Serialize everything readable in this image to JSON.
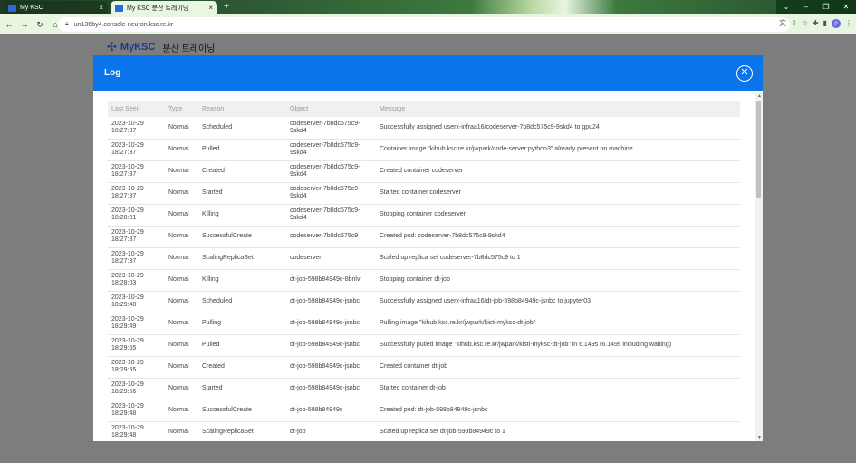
{
  "browser": {
    "tabs": [
      {
        "title": "My KSC"
      },
      {
        "title": "My KSC 분산 트레이닝"
      }
    ],
    "url": "un136by4.console-neuron.ksc.re.kr",
    "profile_initial": "p"
  },
  "page": {
    "brand": "MyKSC",
    "subtitle": "분산 트레이닝"
  },
  "modal": {
    "title": "Log",
    "columns": [
      "Last Seen",
      "Type",
      "Reason",
      "Object",
      "Message"
    ],
    "rows": [
      {
        "last_seen": "2023-10-29 18:27:37",
        "type": "Normal",
        "reason": "Scheduled",
        "object": "codeserver-7b8dc575c9-9skd4",
        "message": "Successfully assigned userx-infraa16/codeserver-7b8dc575c9-9skd4 to gpu24"
      },
      {
        "last_seen": "2023-10-29 18:27:37",
        "type": "Normal",
        "reason": "Pulled",
        "object": "codeserver-7b8dc575c9-9skd4",
        "message": "Container image \"kihub.ksc.re.kr/jwpark/code-server:python3\" already present on machine"
      },
      {
        "last_seen": "2023-10-29 18:27:37",
        "type": "Normal",
        "reason": "Created",
        "object": "codeserver-7b8dc575c9-9skd4",
        "message": "Created container codeserver"
      },
      {
        "last_seen": "2023-10-29 18:27:37",
        "type": "Normal",
        "reason": "Started",
        "object": "codeserver-7b8dc575c9-9skd4",
        "message": "Started container codeserver"
      },
      {
        "last_seen": "2023-10-29 18:28:01",
        "type": "Normal",
        "reason": "Killing",
        "object": "codeserver-7b8dc575c9-9skd4",
        "message": "Stopping container codeserver"
      },
      {
        "last_seen": "2023-10-29 18:27:37",
        "type": "Normal",
        "reason": "SuccessfulCreate",
        "object": "codeserver-7b8dc575c9",
        "message": "Created pod: codeserver-7b8dc575c9-9skd4"
      },
      {
        "last_seen": "2023-10-29 18:27:37",
        "type": "Normal",
        "reason": "ScalingReplicaSet",
        "object": "codeserver",
        "message": "Scaled up replica set codeserver-7b8dc575c9 to 1"
      },
      {
        "last_seen": "2023-10-29 18:28:03",
        "type": "Normal",
        "reason": "Killing",
        "object": "dt-job-598b84949c-8bnlv",
        "message": "Stopping container dt-job"
      },
      {
        "last_seen": "2023-10-29 18:29:48",
        "type": "Normal",
        "reason": "Scheduled",
        "object": "dt-job-598b84949c-jsnbc",
        "message": "Successfully assigned userx-infraa16/dt-job-598b84949c-jsnbc to jupyter03"
      },
      {
        "last_seen": "2023-10-29 18:29:49",
        "type": "Normal",
        "reason": "Pulling",
        "object": "dt-job-598b84949c-jsnbc",
        "message": "Pulling image \"kihub.ksc.re.kr/jwpark/kisti-myksc-dt-job\""
      },
      {
        "last_seen": "2023-10-29 18:29:55",
        "type": "Normal",
        "reason": "Pulled",
        "object": "dt-job-598b84949c-jsnbc",
        "message": "Successfully pulled image \"kihub.ksc.re.kr/jwpark/kisti-myksc-dt-job\" in 6.149s (6.149s including waiting)"
      },
      {
        "last_seen": "2023-10-29 18:29:55",
        "type": "Normal",
        "reason": "Created",
        "object": "dt-job-598b84949c-jsnbc",
        "message": "Created container dt-job"
      },
      {
        "last_seen": "2023-10-29 18:29:56",
        "type": "Normal",
        "reason": "Started",
        "object": "dt-job-598b84949c-jsnbc",
        "message": "Started container dt-job"
      },
      {
        "last_seen": "2023-10-29 18:29:48",
        "type": "Normal",
        "reason": "SuccessfulCreate",
        "object": "dt-job-598b84949c",
        "message": "Created pod: dt-job-598b84949c-jsnbc"
      },
      {
        "last_seen": "2023-10-29 18:29:48",
        "type": "Normal",
        "reason": "ScalingReplicaSet",
        "object": "dt-job",
        "message": "Scaled up replica set dt-job-598b84949c to 1"
      }
    ]
  },
  "colors": {
    "modal_header": "#0a74ea",
    "overlay": "#7d7d7d"
  }
}
